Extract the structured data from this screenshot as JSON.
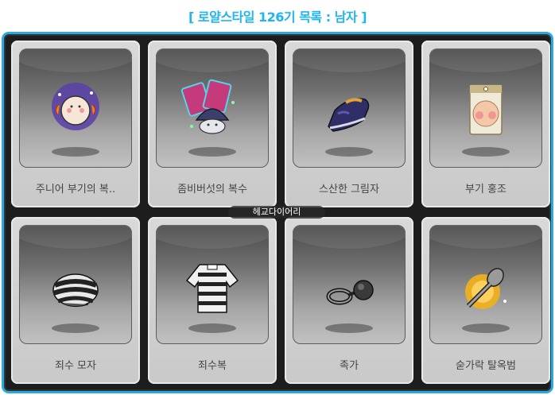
{
  "header": {
    "title": "[ 로얄스타일 126기 목록 : 남자 ]"
  },
  "items": [
    {
      "label": "주니어 부기의 복..",
      "icon": "junior-boogie-costume-icon"
    },
    {
      "label": "좀비버섯의 복수",
      "icon": "zombie-mushroom-revenge-icon"
    },
    {
      "label": "스산한 그림자",
      "icon": "eerie-shadow-shoe-icon"
    },
    {
      "label": "부기 홍조",
      "icon": "boogie-blush-icon"
    },
    {
      "label": "죄수 모자",
      "icon": "prisoner-hat-icon"
    },
    {
      "label": "죄수복",
      "icon": "prisoner-outfit-icon"
    },
    {
      "label": "족가",
      "icon": "shackles-icon"
    },
    {
      "label": "숟가락 탈옥범",
      "icon": "spoon-escapee-icon"
    }
  ],
  "watermark": "헤교다이어리",
  "colors": {
    "accent": "#29abe2",
    "title": "#1fb6f0",
    "board": "#1d1d1d"
  }
}
